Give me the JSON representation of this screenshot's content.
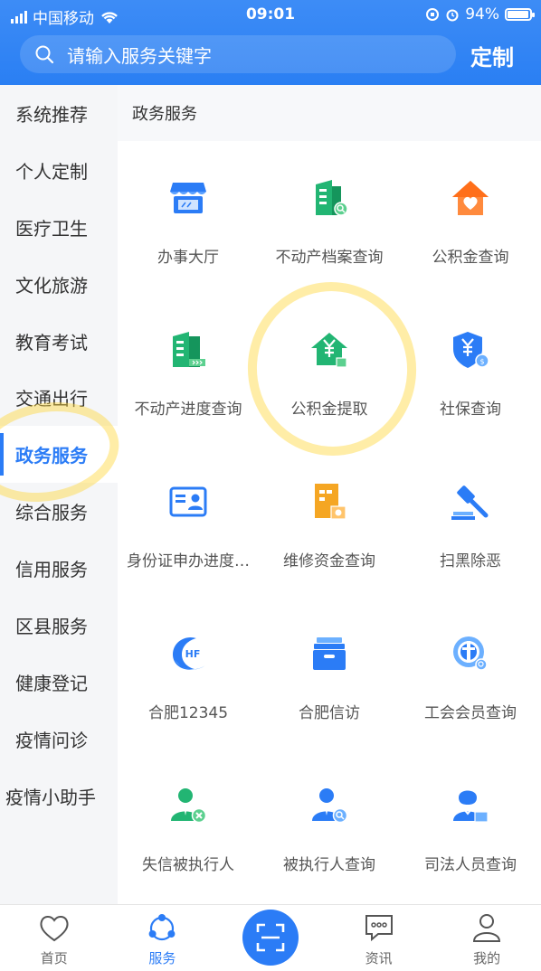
{
  "status_bar": {
    "carrier": "中国移动",
    "time": "09:01",
    "battery": "94%"
  },
  "search": {
    "placeholder": "请输入服务关键字"
  },
  "header": {
    "custom_label": "定制"
  },
  "sidebar": {
    "items": [
      {
        "label": "系统推荐"
      },
      {
        "label": "个人定制"
      },
      {
        "label": "医疗卫生"
      },
      {
        "label": "文化旅游"
      },
      {
        "label": "教育考试"
      },
      {
        "label": "交通出行"
      },
      {
        "label": "政务服务",
        "active": true
      },
      {
        "label": "综合服务"
      },
      {
        "label": "信用服务"
      },
      {
        "label": "区县服务"
      },
      {
        "label": "健康登记"
      },
      {
        "label": "疫情问诊"
      },
      {
        "label": "疫情小助手"
      }
    ]
  },
  "main": {
    "section_title": "政务服务",
    "services": [
      {
        "label": "办事大厅",
        "icon": "shop-icon"
      },
      {
        "label": "不动产档案查询",
        "icon": "building-search-icon"
      },
      {
        "label": "公积金查询",
        "icon": "house-heart-icon"
      },
      {
        "label": "不动产进度查询",
        "icon": "building-progress-icon"
      },
      {
        "label": "公积金提取",
        "icon": "house-yuan-icon"
      },
      {
        "label": "社保查询",
        "icon": "shield-yuan-icon"
      },
      {
        "label": "身份证申办进度…",
        "icon": "id-card-icon"
      },
      {
        "label": "维修资金查询",
        "icon": "document-money-icon"
      },
      {
        "label": "扫黑除恶",
        "icon": "gavel-icon"
      },
      {
        "label": "合肥12345",
        "icon": "hotline-icon"
      },
      {
        "label": "合肥信访",
        "icon": "inbox-icon"
      },
      {
        "label": "工会会员查询",
        "icon": "union-logo-icon"
      },
      {
        "label": "失信被执行人",
        "icon": "person-x-icon"
      },
      {
        "label": "被执行人查询",
        "icon": "person-search-icon"
      },
      {
        "label": "司法人员查询",
        "icon": "judge-icon"
      }
    ]
  },
  "tabbar": {
    "home": "首页",
    "service": "服务",
    "news": "资讯",
    "mine": "我的"
  },
  "colors": {
    "accent": "#2b7cf6",
    "green": "#22b573",
    "orange": "#f5a623",
    "highlight": "#ffd73c"
  }
}
